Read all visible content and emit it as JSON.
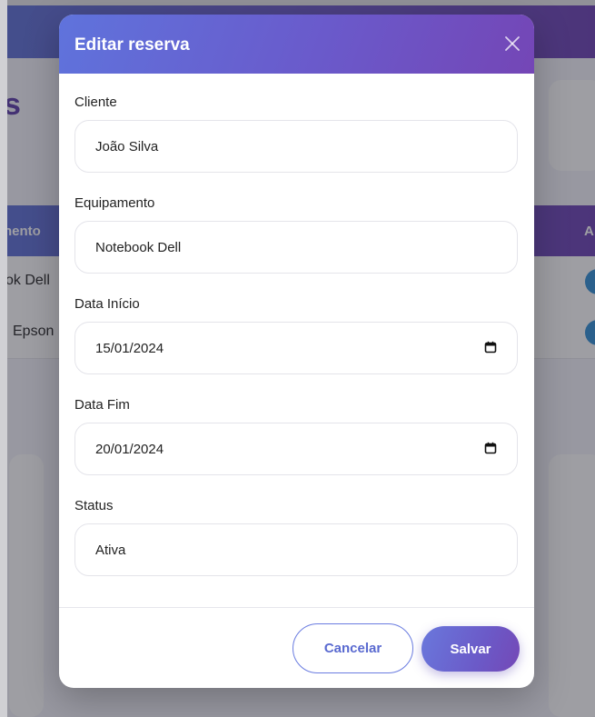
{
  "background": {
    "page_title_fragment": "s",
    "table_header_fragment_left": "nento",
    "table_header_fragment_right": "A",
    "rows": [
      {
        "equipment_fragment": "ok Dell"
      },
      {
        "equipment_fragment": "Epson"
      }
    ]
  },
  "modal": {
    "title": "Editar reserva",
    "close_icon": "close-icon",
    "fields": {
      "cliente": {
        "label": "Cliente",
        "value": "João Silva"
      },
      "equipamento": {
        "label": "Equipamento",
        "value": "Notebook Dell"
      },
      "data_inicio": {
        "label": "Data Início",
        "value": "15/01/2024",
        "icon": "calendar-icon"
      },
      "data_fim": {
        "label": "Data Fim",
        "value": "20/01/2024",
        "icon": "calendar-icon"
      },
      "status": {
        "label": "Status",
        "value": "Ativa"
      }
    },
    "buttons": {
      "cancel_label": "Cancelar",
      "save_label": "Salvar"
    }
  },
  "colors": {
    "accent_start": "#5f73dc",
    "accent_end": "#7446b6",
    "cancel_text": "#5a6ad0"
  }
}
